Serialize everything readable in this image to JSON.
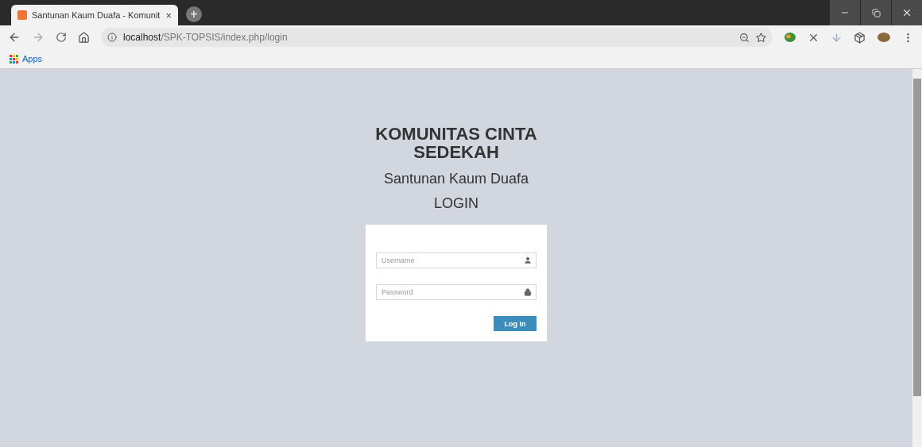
{
  "tab": {
    "title": "Santunan Kaum Duafa - Komunit",
    "selected": true,
    "close": "×"
  },
  "new_tab": "+",
  "address": {
    "host": "localhost",
    "path": "/SPK-TOPSIS/index.php/login"
  },
  "bookmarks": [
    {
      "label": "Apps"
    }
  ],
  "page": {
    "title": "KOMUNITAS CINTA SEDEKAH",
    "subtitle": "Santunan Kaum Duafa",
    "heading": "LOGIN",
    "fields": [
      {
        "placeholder": "Username",
        "kind": "user"
      },
      {
        "placeholder": "Password",
        "kind": "lock"
      }
    ],
    "button": "Log In"
  }
}
